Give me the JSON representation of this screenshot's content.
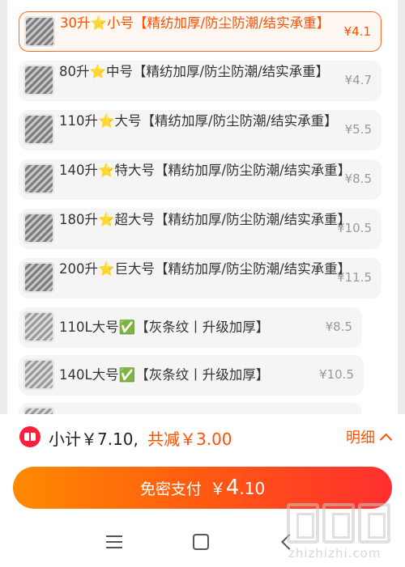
{
  "options": [
    {
      "name": "30升⭐小号【精纺加厚/防尘防潮/结实承重】",
      "price": "¥4.1",
      "selected": true
    },
    {
      "name": "80升⭐中号【精纺加厚/防尘防潮/结实承重】",
      "price": "¥4.7",
      "selected": false
    },
    {
      "name": "110升⭐大号【精纺加厚/防尘防潮/结实承重】",
      "price": "¥5.5",
      "selected": false
    },
    {
      "name": "140升⭐特大号【精纺加厚/防尘防潮/结实承重】",
      "price": "¥8.5",
      "selected": false
    },
    {
      "name": "180升⭐超大号【精纺加厚/防尘防潮/结实承重】",
      "price": "¥10.5",
      "selected": false
    },
    {
      "name": "200升⭐巨大号【精纺加厚/防尘防潮/结实承重】",
      "price": "¥11.5",
      "selected": false
    },
    {
      "name": "110L大号✅【灰条纹丨升级加厚】",
      "price": "¥8.5",
      "selected": false
    },
    {
      "name": "140L大号✅【灰条纹丨升级加厚】",
      "price": "¥10.5",
      "selected": false
    }
  ],
  "footer": {
    "subtotal": "小计￥7.10,",
    "discount": "共减￥3.00",
    "detail_label": "明细",
    "pay_label": "免密支付",
    "pay_currency": "￥",
    "pay_integer": "4",
    "pay_decimal": ".10"
  },
  "icons": {
    "coupon": "coupon-icon",
    "chevron": "chevron-up-icon",
    "nav_menu": "menu-icon",
    "nav_home": "home-icon",
    "nav_back": "back-icon"
  },
  "watermark": {
    "text": "zhizhizhi.com"
  },
  "colors": {
    "accent": "#ff5000",
    "pay_start": "#ff8a00",
    "pay_end": "#ff2f2f",
    "coupon": "#ff1f3d"
  }
}
